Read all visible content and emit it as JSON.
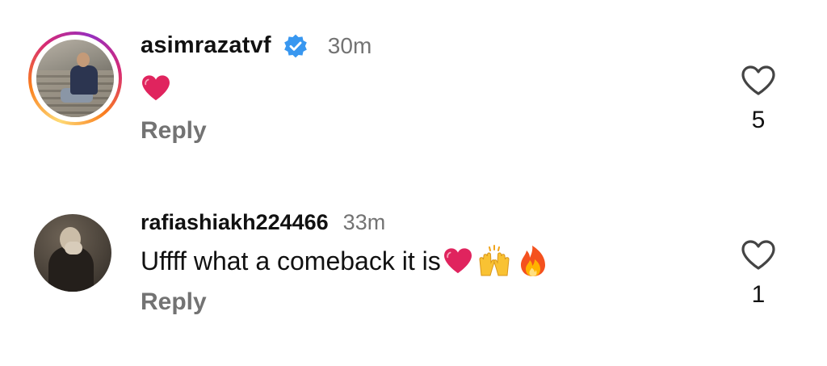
{
  "comments": [
    {
      "username": "asimrazatvf",
      "verified": true,
      "time": "30m",
      "text": "",
      "emojis": [
        "red-heart"
      ],
      "reply_label": "Reply",
      "like_count": "5",
      "avatar_story_ring": true
    },
    {
      "username": "rafiashiakh224466",
      "verified": false,
      "time": "33m",
      "text": "Uffff what a comeback it is",
      "emojis": [
        "red-heart",
        "raising-hands",
        "fire"
      ],
      "reply_label": "Reply",
      "like_count": "1",
      "avatar_story_ring": false
    }
  ],
  "colors": {
    "verified_blue": "#3897f0",
    "secondary_text": "#737373",
    "heart_red": "#e0245e"
  },
  "icons": [
    "verified-badge-icon",
    "heart-outline-icon",
    "red-heart-emoji",
    "raising-hands-emoji",
    "fire-emoji"
  ]
}
